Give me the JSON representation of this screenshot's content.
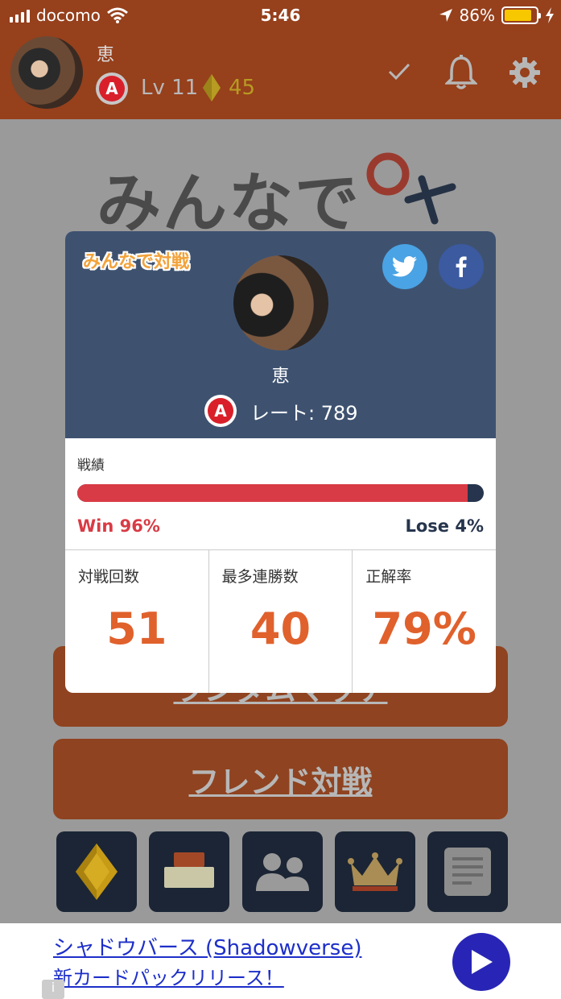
{
  "status_bar": {
    "carrier": "docomo",
    "time": "5:46",
    "battery": "86%"
  },
  "header": {
    "username": "恵",
    "rank_letter": "A",
    "level": "Lv 11",
    "coins": "45"
  },
  "background": {
    "title": "みんなで",
    "buttons": [
      {
        "label": "ランダムマッチ"
      },
      {
        "label": "フレンド対戦"
      }
    ],
    "tiles": [
      {
        "icon": "gem-icon"
      },
      {
        "icon": "button-icon"
      },
      {
        "icon": "friends-icon"
      },
      {
        "icon": "crown-icon"
      },
      {
        "icon": "document-icon"
      }
    ]
  },
  "card": {
    "tag": "みんなで対戦",
    "name": "恵",
    "rank_letter": "A",
    "rate": "レート: 789",
    "stats_label": "戦績",
    "win_fraction": 0.96,
    "win_text": "Win 96%",
    "lose_text": "Lose 4%",
    "cells": [
      {
        "label": "対戦回数",
        "value": "51"
      },
      {
        "label": "最多連勝数",
        "value": "40"
      },
      {
        "label": "正解率",
        "value": "79%"
      }
    ]
  },
  "ad": {
    "line1": "シャドウバース (Shadowverse)",
    "line2": "新カードパックリリース！",
    "info": "i"
  },
  "colors": {
    "header_orange": "#96401c",
    "card_navy": "#3e5270",
    "win_red": "#d83b45",
    "value_orange": "#e0612c",
    "ad_link": "#1d2fc9"
  }
}
